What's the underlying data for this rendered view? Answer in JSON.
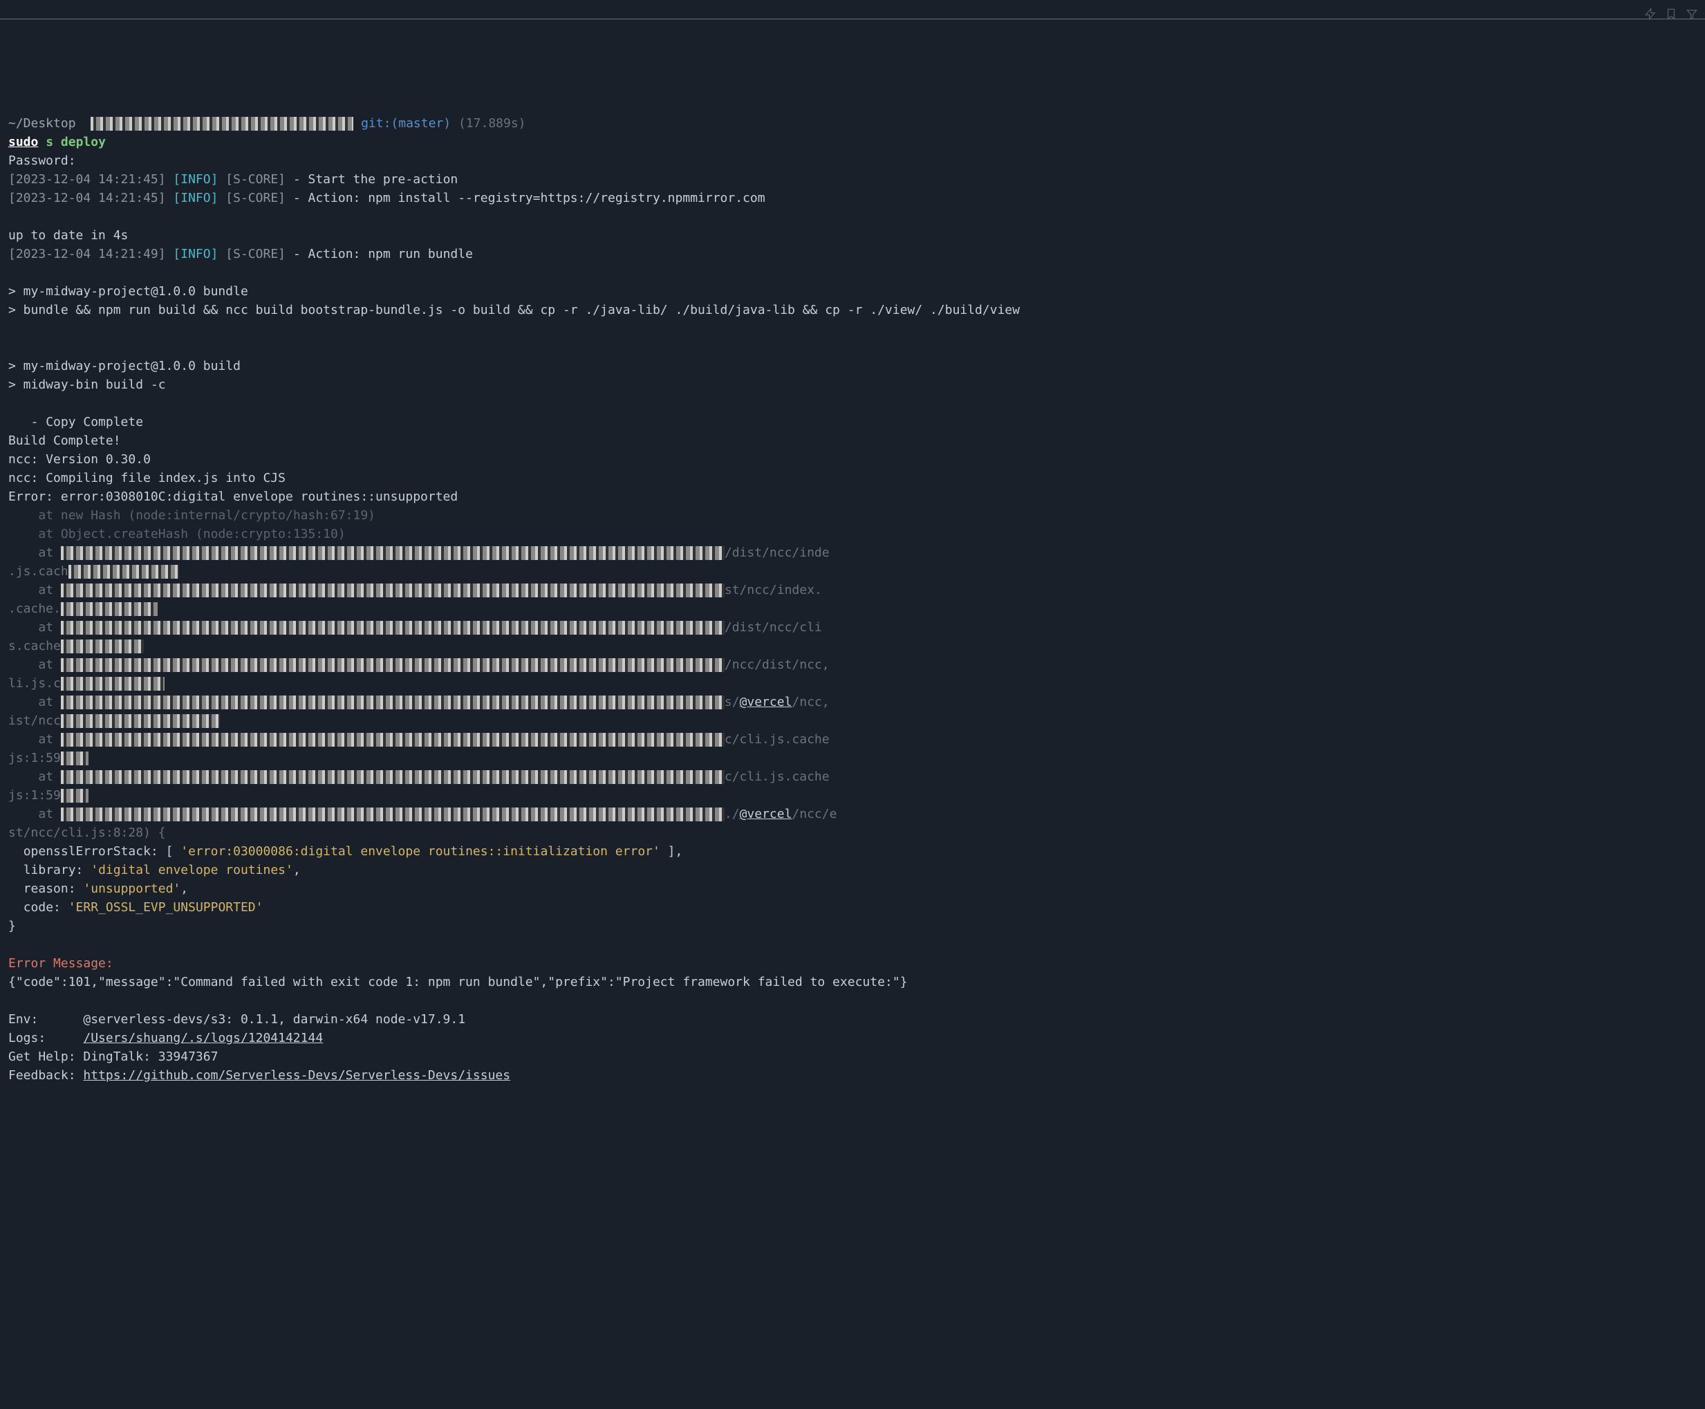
{
  "prompt": {
    "path_prefix": "~/Desktop",
    "git_branch": "git:(master)",
    "timing": "(17.889s)"
  },
  "command": {
    "sudo": "sudo",
    "s": "s",
    "deploy": "deploy"
  },
  "password_label": "Password:",
  "log1": {
    "ts": "[2023-12-04 14:21:45]",
    "level": "[INFO]",
    "mod": "[S-CORE]",
    "msg": " - Start the pre-action"
  },
  "log2": {
    "ts": "[2023-12-04 14:21:45]",
    "level": "[INFO]",
    "mod": "[S-CORE]",
    "msg": " - Action: npm install --registry=https://registry.npmmirror.com"
  },
  "uptodate": "up to date in 4s",
  "log3": {
    "ts": "[2023-12-04 14:21:49]",
    "level": "[INFO]",
    "mod": "[S-CORE]",
    "msg": " - Action: npm run bundle"
  },
  "npm_bundle_header": "> my-midway-project@1.0.0 bundle",
  "npm_bundle_cmd": "> bundle && npm run build && ncc build bootstrap-bundle.js -o build && cp -r ./java-lib/ ./build/java-lib && cp -r ./view/ ./build/view",
  "npm_build_header": "> my-midway-project@1.0.0 build",
  "npm_build_cmd": "> midway-bin build -c",
  "copy_complete": "   - Copy Complete",
  "build_complete": "Build Complete!",
  "ncc_ver": "ncc: Version 0.30.0",
  "ncc_compile": "ncc: Compiling file index.js into CJS",
  "error_line": "Error: error:0308010C:digital envelope routines::unsupported",
  "stack1": "    at new Hash (node:internal/crypto/hash:67:19)",
  "stack2": "    at Object.createHash (node:crypto:135:10)",
  "stack3_at": "    at ",
  "stack3_tail": "/dist/ncc/inde",
  "stack3_line2": ".js.cach",
  "stack4_at": "    at ",
  "stack4_tail": "st/ncc/index.",
  "stack4_line2": ".cache.",
  "stack5_at": "    at ",
  "stack5_tail": "/dist/ncc/cli",
  "stack5_line2": "s.cache",
  "stack6_at": "    at ",
  "stack6_tail": "/ncc/dist/ncc,",
  "stack6_line2": "li.js.c",
  "stack7_at": "    at ",
  "stack7_tail_link": "@vercel",
  "stack7_tail2": "/ncc,",
  "stack7_line2": "ist/ncc",
  "stack8_at": "    at ",
  "stack8_tail": "c/cli.js.cache",
  "stack8_line2": "js:1:59",
  "stack9_at": "    at ",
  "stack9_tail": "c/cli.js.cache",
  "stack9_line2": "js:1:59",
  "stack10_at": "    at ",
  "stack10_tail_link": "@vercel",
  "stack10_tail2": "/ncc/e",
  "stack10_line2": "st/ncc/cli.js:8:28) {",
  "ossl_label": "  opensslErrorStack: [ ",
  "ossl_val": "'error:03000086:digital envelope routines::initialization error'",
  "ossl_close": " ],",
  "library_label": "  library: ",
  "library_val": "'digital envelope routines'",
  "comma": ",",
  "reason_label": "  reason: ",
  "reason_val": "'unsupported'",
  "code_label": "  code: ",
  "code_val": "'ERR_OSSL_EVP_UNSUPPORTED'",
  "close_brace": "}",
  "error_message_label": "Error Message:",
  "error_message_body": "{\"code\":101,\"message\":\"Command failed with exit code 1: npm run bundle\",\"prefix\":\"Project framework failed to execute:\"}",
  "env_label": "Env:      ",
  "env_val": "@serverless-devs/s3: 0.1.1, darwin-x64 node-v17.9.1",
  "logs_label": "Logs:     ",
  "logs_val": "/Users/shuang/.s/logs/1204142144",
  "help_label": "Get Help: ",
  "help_val": "DingTalk: 33947367",
  "feedback_label": "Feedback: ",
  "feedback_val": "https://github.com/Serverless-Devs/Serverless-Devs/issues"
}
